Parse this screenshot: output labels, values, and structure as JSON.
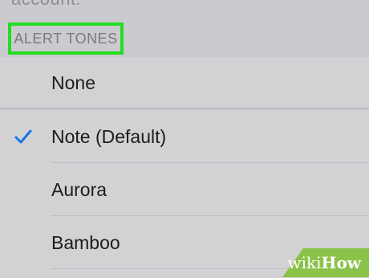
{
  "header": {
    "partial_text": "account.",
    "section_title": "ALERT TONES"
  },
  "group1": {
    "items": [
      {
        "label": "None",
        "selected": false
      }
    ]
  },
  "group2": {
    "items": [
      {
        "label": "Note (Default)",
        "selected": true
      },
      {
        "label": "Aurora",
        "selected": false
      },
      {
        "label": "Bamboo",
        "selected": false
      }
    ]
  },
  "watermark": {
    "wiki": "wiki",
    "how": "How"
  },
  "colors": {
    "highlight_border": "#22dd22",
    "checkmark": "#1a73e8",
    "watermark_bg": "#8bc34a"
  },
  "icons": {
    "checkmark": "checkmark-icon"
  }
}
